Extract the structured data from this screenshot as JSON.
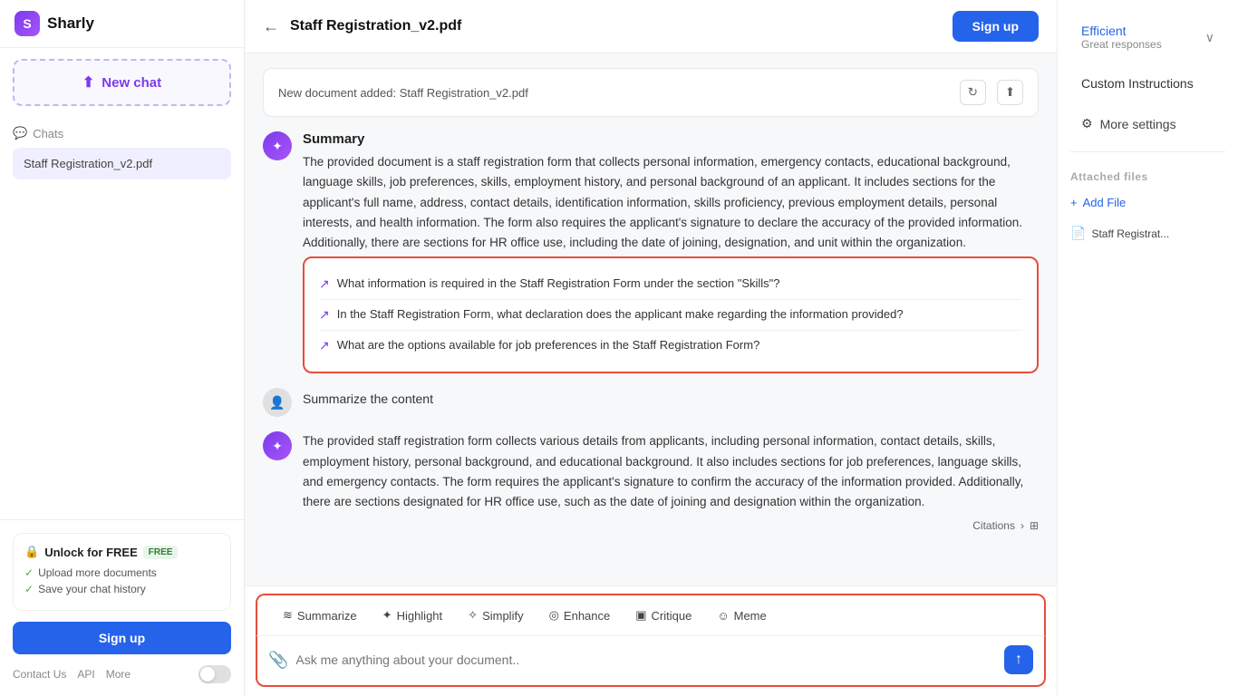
{
  "app": {
    "name": "Sharly",
    "logo_letter": "S"
  },
  "sidebar": {
    "new_chat_label": "New chat",
    "chats_label": "Chats",
    "chat_items": [
      {
        "label": "Staff Registration_v2.pdf"
      }
    ],
    "unlock": {
      "title": "Unlock for FREE",
      "badge": "FREE",
      "items": [
        "Upload more documents",
        "Save your chat history"
      ],
      "sign_up_label": "Sign up"
    },
    "footer_links": [
      "Contact Us",
      "API",
      "More"
    ]
  },
  "header": {
    "doc_title": "Staff Registration_v2.pdf",
    "sign_up_label": "Sign up"
  },
  "chat": {
    "doc_notice": "New document added: Staff Registration_v2.pdf",
    "messages": [
      {
        "type": "ai",
        "summary_title": "Summary",
        "text": "The provided document is a staff registration form that collects personal information, emergency contacts, educational background, language skills, job preferences, skills, employment history, and personal background of an applicant. It includes sections for the applicant's full name, address, contact details, identification information, skills proficiency, previous employment details, personal interests, and health information. The form also requires the applicant's signature to declare the accuracy of the provided information. Additionally, there are sections for HR office use, including the date of joining, designation, and unit within the organization."
      }
    ],
    "suggestions": [
      "What information is required in the Staff Registration Form under the section \"Skills\"?",
      "In the Staff Registration Form, what declaration does the applicant make regarding the information provided?",
      "What are the options available for job preferences in the Staff Registration Form?"
    ],
    "user_message": "Summarize the content",
    "second_response": "The provided staff registration form collects various details from applicants, including personal information, contact details, skills, employment history, personal background, and educational background. It also includes sections for job preferences, language skills, and emergency contacts. The form requires the applicant's signature to confirm the accuracy of the information provided. Additionally, there are sections designated for HR office use, such as the date of joining and designation within the organization.",
    "citations_label": "Citations",
    "input_placeholder": "Ask me anything about your document.."
  },
  "actions": [
    {
      "label": "Summarize",
      "icon": "≋"
    },
    {
      "label": "Highlight",
      "icon": "✦"
    },
    {
      "label": "Simplify",
      "icon": "✧"
    },
    {
      "label": "Enhance",
      "icon": "◎"
    },
    {
      "label": "Critique",
      "icon": "▣"
    },
    {
      "label": "Meme",
      "icon": "☺"
    }
  ],
  "right_panel": {
    "efficient_label": "Efficient",
    "efficient_sub": "Great responses",
    "custom_instructions_label": "Custom Instructions",
    "more_settings_label": "More settings",
    "attached_files_label": "Attached files",
    "add_file_label": "Add File",
    "files": [
      {
        "name": "Staff Registrat..."
      }
    ]
  }
}
